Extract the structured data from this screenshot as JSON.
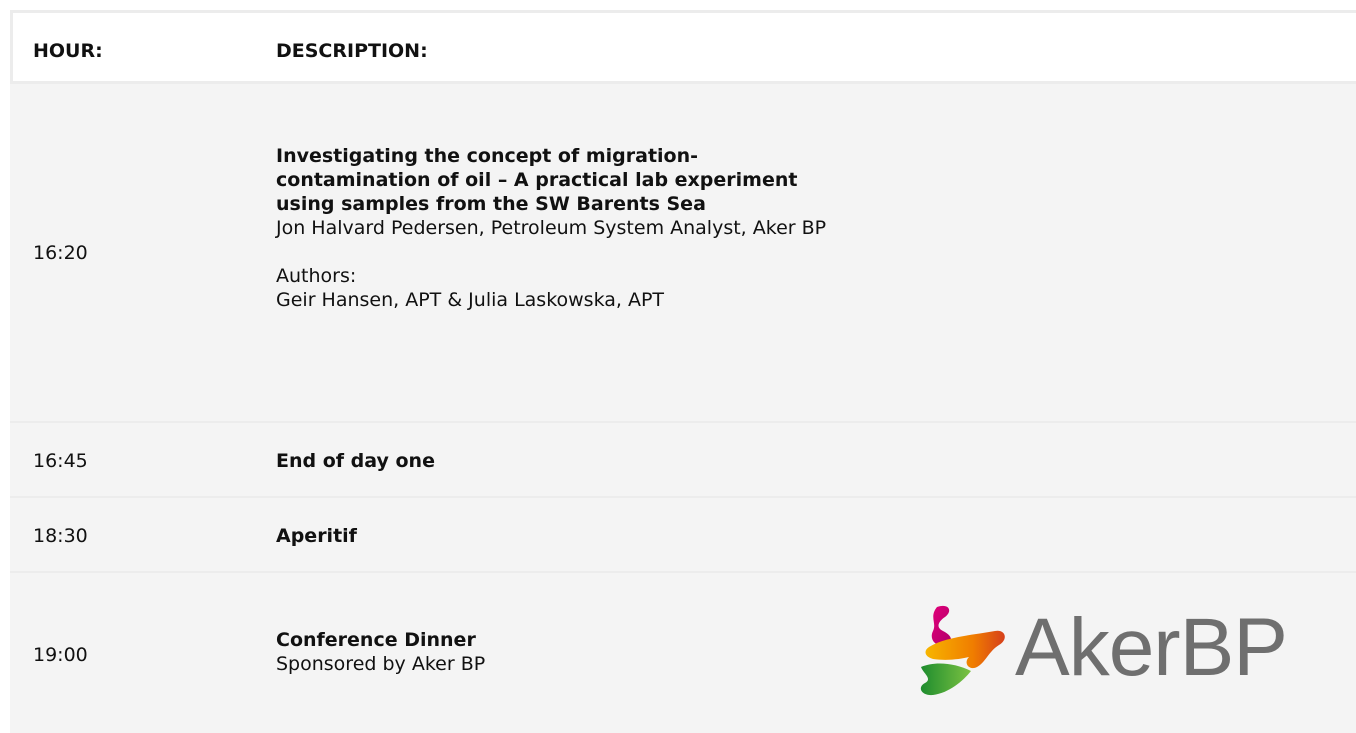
{
  "header": {
    "hour_label": "HOUR:",
    "description_label": "DESCRIPTION:"
  },
  "rows": [
    {
      "hour": "16:20",
      "title": "Investigating the concept of migration-contamination of oil – A practical lab experiment using samples from the SW Barents Sea",
      "speaker": "Jon Halvard Pedersen, Petroleum System Analyst, Aker BP",
      "authors_label": "Authors:",
      "authors": "Geir Hansen, APT & Julia Laskowska, APT"
    },
    {
      "hour": "16:45",
      "title": "End of day one"
    },
    {
      "hour": "18:30",
      "title": "Aperitif"
    },
    {
      "hour": "19:00",
      "title": "Conference Dinner",
      "subtitle": "Sponsored by Aker BP",
      "logo_text": "AkerBP"
    }
  ],
  "colors": {
    "row_background": "#f4f4f4",
    "divider": "#ececec",
    "logo_text": "#6f6f6f"
  }
}
